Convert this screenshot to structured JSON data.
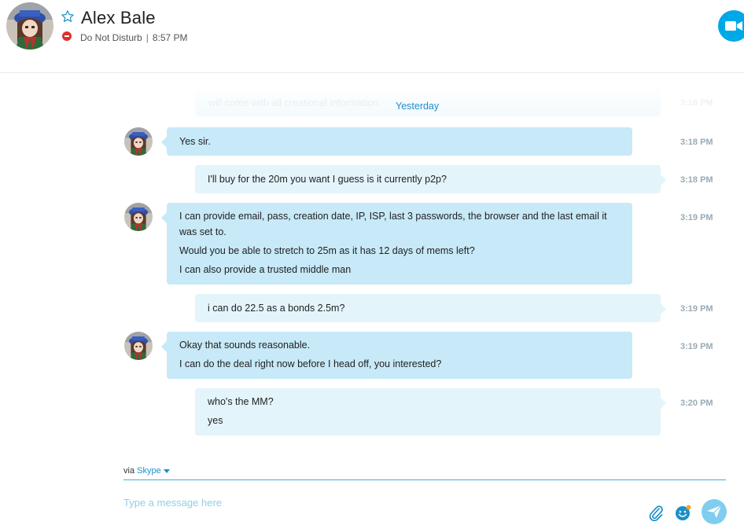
{
  "header": {
    "contact_name": "Alex Bale",
    "status": "Do Not Disturb",
    "status_separator": "|",
    "time": "8:57 PM"
  },
  "conversation": {
    "ghost_preview": "will come with all creational information.",
    "ghost_time": "3:18 PM",
    "day_separator": "Yesterday",
    "messages": [
      {
        "direction": "incoming",
        "time": "3:18 PM",
        "lines": [
          "Yes sir."
        ]
      },
      {
        "direction": "outgoing",
        "time": "3:18 PM",
        "lines": [
          "I'll buy for the 20m you want I guess is it currently p2p?"
        ]
      },
      {
        "direction": "incoming",
        "time": "3:19 PM",
        "lines": [
          "I can provide email, pass, creation date, IP, ISP, last 3 passwords, the browser and the last email it was set to.",
          "Would you be able to stretch to 25m as it has 12 days of mems left?",
          "I can also provide a trusted middle man"
        ]
      },
      {
        "direction": "outgoing",
        "time": "3:19 PM",
        "lines": [
          "i can do 22.5 as a bonds 2.5m?"
        ]
      },
      {
        "direction": "incoming",
        "time": "3:19 PM",
        "lines": [
          "Okay that sounds reasonable.",
          "I can do the deal right now before I head off, you interested?"
        ]
      },
      {
        "direction": "outgoing",
        "time": "3:20 PM",
        "lines": [
          "who's the MM?",
          "yes"
        ]
      }
    ]
  },
  "composer": {
    "via_label": "via",
    "service": "Skype",
    "placeholder": "Type a message here"
  },
  "icons": {
    "favorite": "star-icon",
    "status": "do-not-disturb-icon",
    "video": "video-call-icon",
    "attach": "paperclip-icon",
    "emoji": "emoji-icon",
    "send": "send-icon"
  },
  "colors": {
    "accent": "#00a8e8",
    "incoming_bubble": "#c7e9f8",
    "outgoing_bubble": "#e4f4fb",
    "dnd": "#e0302e",
    "timestamp": "#99aab5"
  }
}
